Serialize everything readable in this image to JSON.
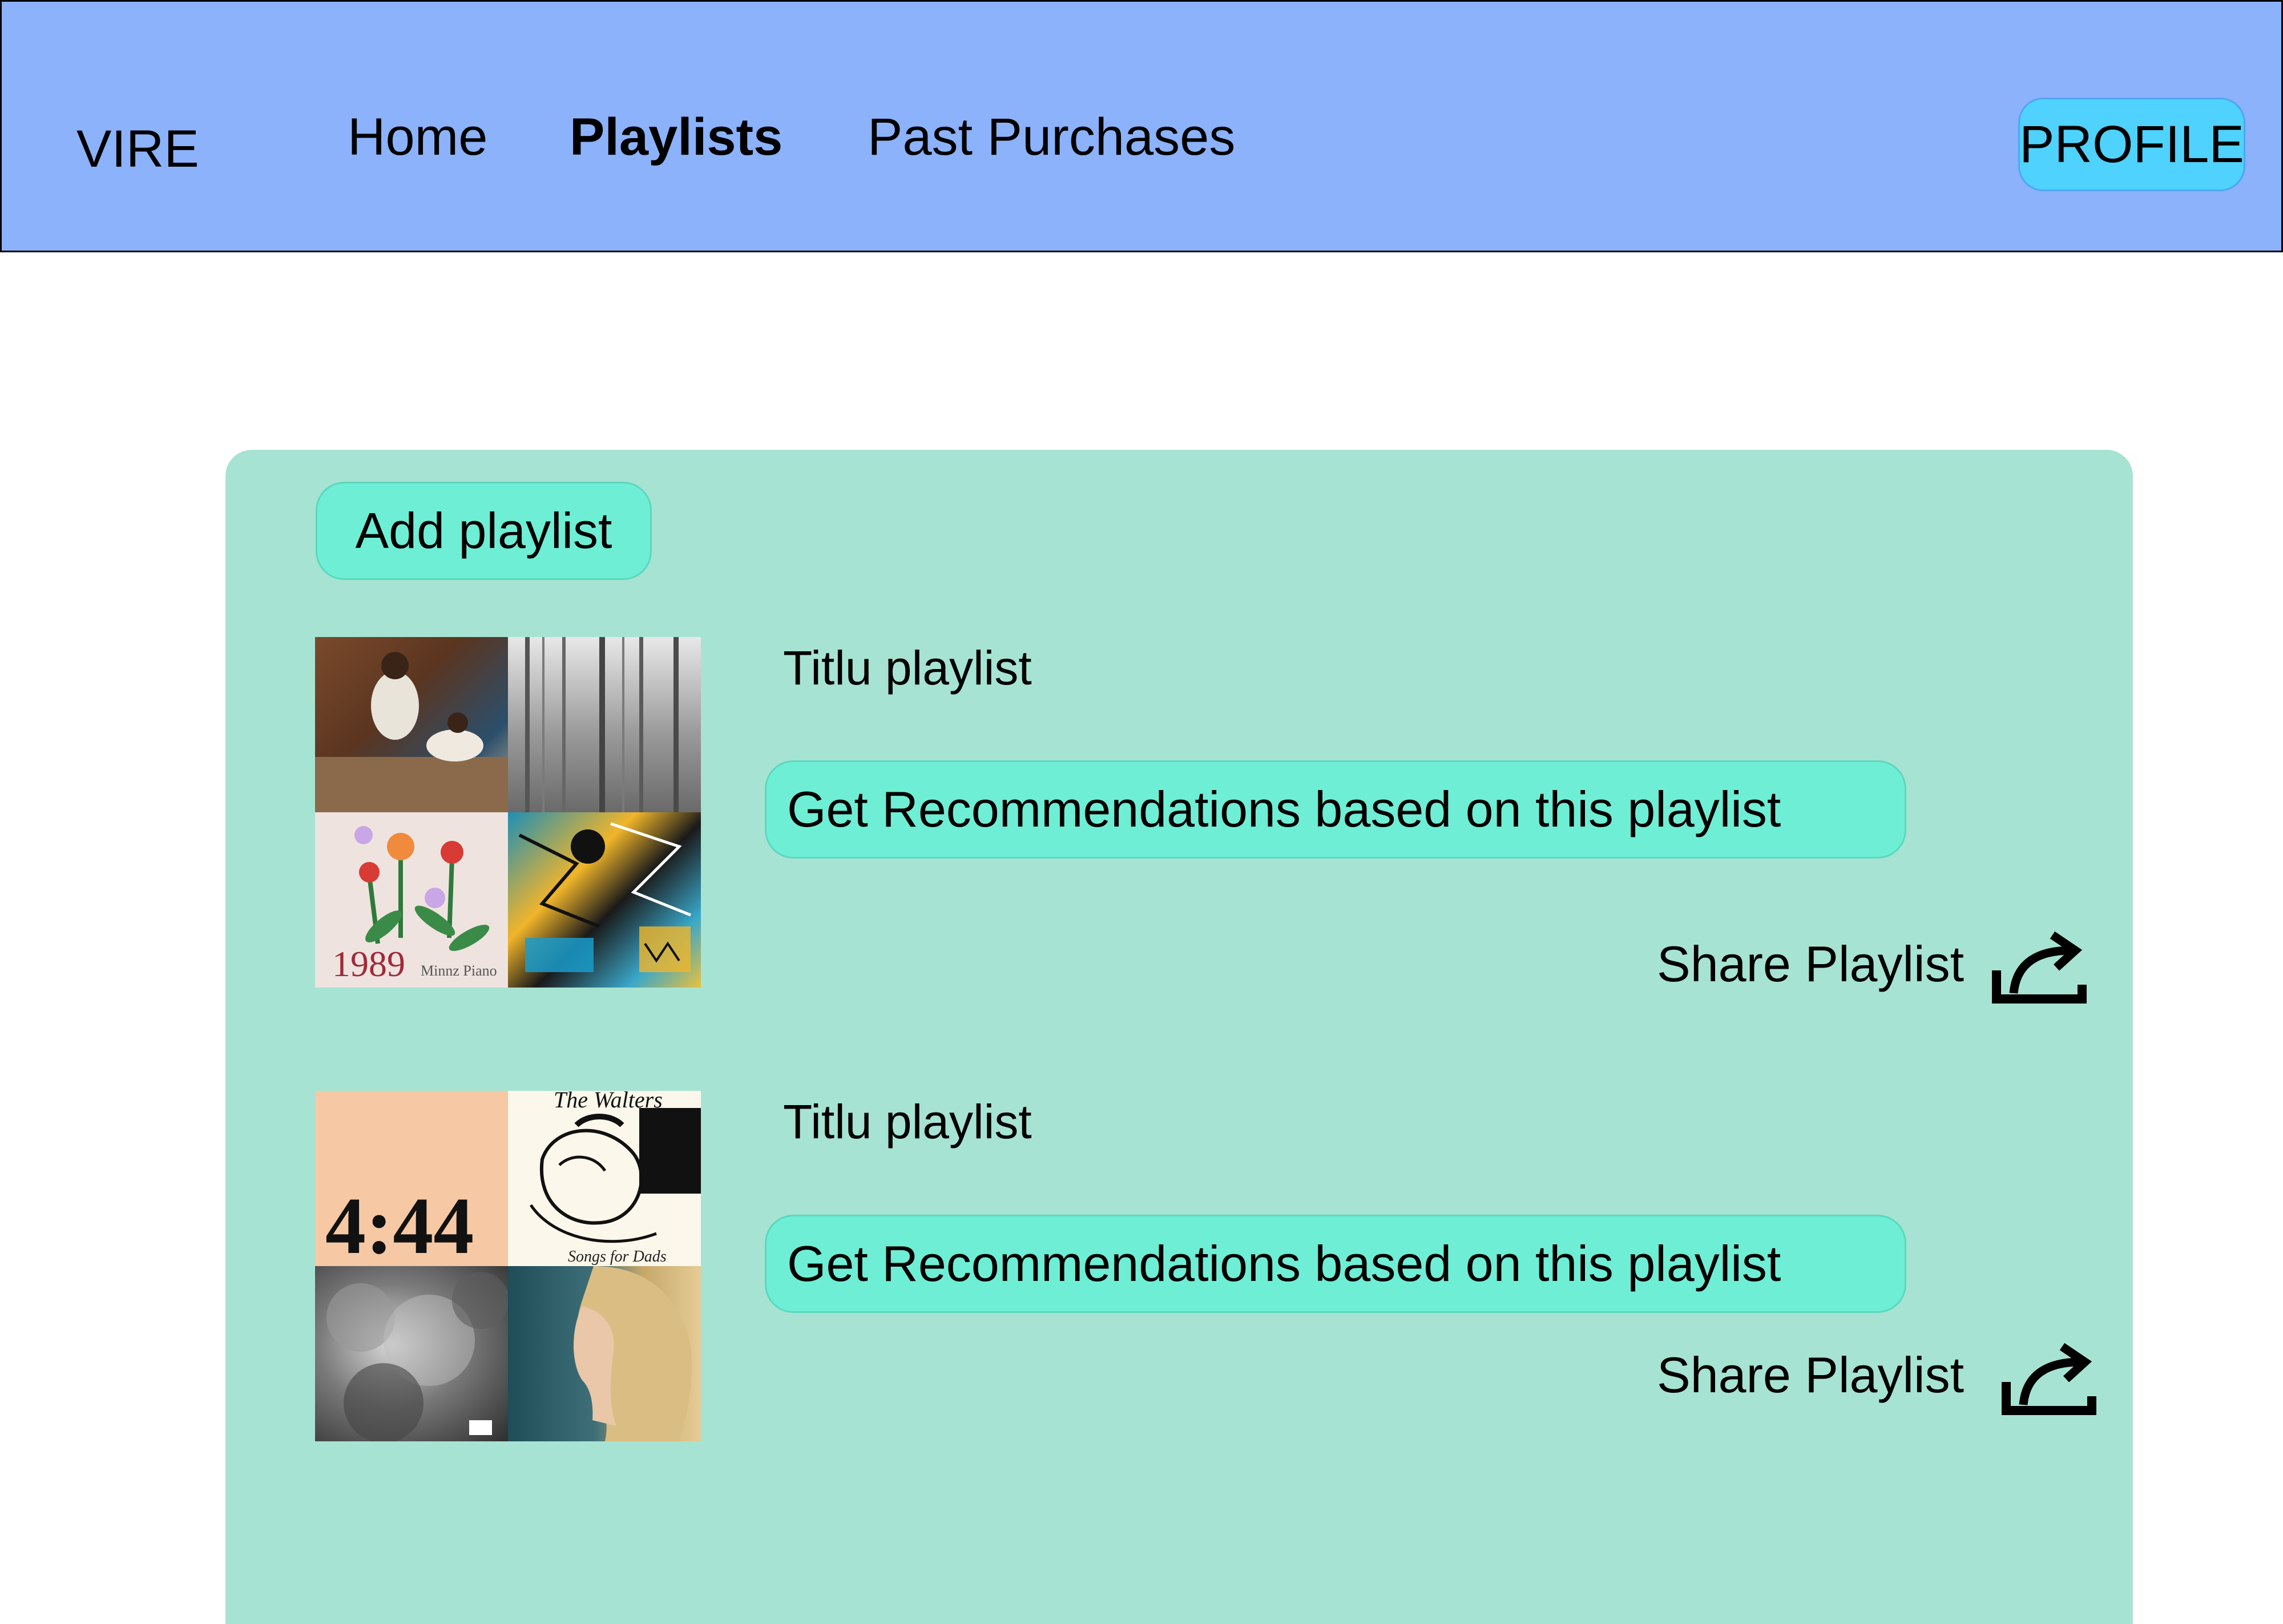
{
  "nav": {
    "brand": "VIRE",
    "home": "Home",
    "playlists": "Playlists",
    "past_purchases": "Past Purchases",
    "profile": "PROFILE"
  },
  "panel": {
    "add_playlist": "Add playlist"
  },
  "playlists": [
    {
      "title": "Titlu playlist",
      "recommend_label": "Get Recommendations based on this playlist",
      "share_label": "Share Playlist",
      "covers": [
        {
          "name": "album-cover-family-portrait",
          "text": ""
        },
        {
          "name": "album-cover-misty-forest",
          "text": ""
        },
        {
          "name": "album-cover-tulips",
          "text": "1989",
          "subtext": "Minnz Piano"
        },
        {
          "name": "album-cover-graffiti-art",
          "text": ""
        }
      ]
    },
    {
      "title": "Titlu playlist",
      "recommend_label": "Get Recommendations based on this playlist",
      "share_label": "Share Playlist",
      "covers": [
        {
          "name": "album-cover-444",
          "text": "4:44"
        },
        {
          "name": "album-cover-the-walters",
          "text": "The Walters",
          "subtext": "Songs for Dads"
        },
        {
          "name": "album-cover-storm-clouds",
          "text": ""
        },
        {
          "name": "album-cover-portrait-profile",
          "text": ""
        }
      ]
    }
  ],
  "colors": {
    "navbar": "#8bb2fb",
    "profile_button": "#4fd2fe",
    "panel": "#a7e3d2",
    "pill_button": "#6eeed5"
  },
  "icons": {
    "share": "share-arrow-icon"
  }
}
